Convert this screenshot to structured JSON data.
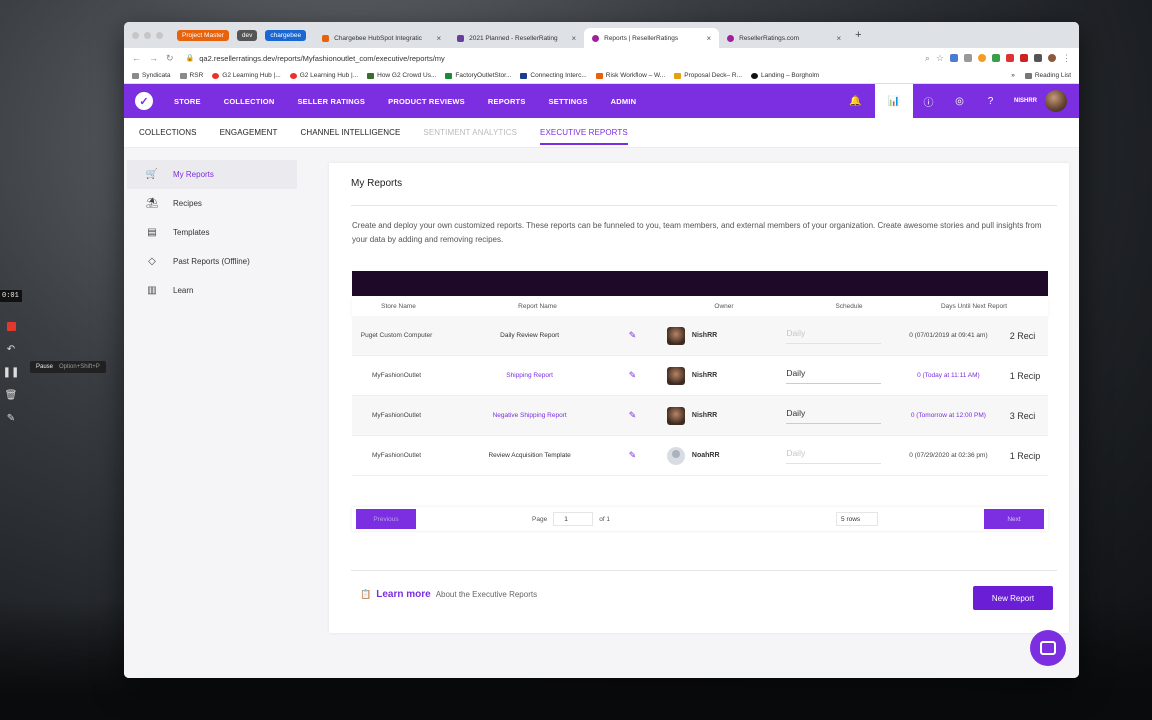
{
  "recorder": {
    "time": "0:01",
    "tooltip": "Pause",
    "tooltip_kbd": "Option+Shift+P"
  },
  "browser": {
    "pills": [
      "Project Master",
      "dev",
      "chargebee"
    ],
    "tabs": [
      {
        "label": "Chargebee HubSpot Integratic",
        "color": "#e8620c"
      },
      {
        "label": "2021 Planned - ResellerRating",
        "color": "#6a3e9e"
      },
      {
        "label": "Reports | ResellerRatings",
        "color": "#a0209e"
      },
      {
        "label": "ResellerRatings.com",
        "color": "#a0209e"
      }
    ],
    "url": "qa2.resellerratings.dev/reports/Myfashionoutlet_com/executive/reports/my",
    "bookmarks": [
      {
        "label": "Syndicata",
        "color": "#8a8a8a"
      },
      {
        "label": "RSR",
        "color": "#8a8a8a"
      },
      {
        "label": "G2 Learning Hub |...",
        "color": "#e8332a"
      },
      {
        "label": "G2 Learning Hub |...",
        "color": "#e8332a"
      },
      {
        "label": "How G2 Crowd Us...",
        "color": "#3b6e2e"
      },
      {
        "label": "FactoryOutletStor...",
        "color": "#1a8a3a"
      },
      {
        "label": "Connecting Interc...",
        "color": "#1b3d8f"
      },
      {
        "label": "Risk Workflow – W...",
        "color": "#e8620c"
      },
      {
        "label": "Proposal Deck– R...",
        "color": "#e5a00d"
      },
      {
        "label": "Landing – Borgholm",
        "color": "#111111"
      }
    ],
    "reading_list": "Reading List"
  },
  "nav": {
    "items": [
      "STORE",
      "COLLECTION",
      "SELLER RATINGS",
      "PRODUCT REVIEWS",
      "REPORTS",
      "SETTINGS",
      "ADMIN"
    ],
    "user": "NISHRR"
  },
  "subnav": {
    "items": [
      {
        "label": "COLLECTIONS",
        "state": "normal"
      },
      {
        "label": "ENGAGEMENT",
        "state": "normal"
      },
      {
        "label": "CHANNEL INTELLIGENCE",
        "state": "normal"
      },
      {
        "label": "SENTIMENT ANALYTICS",
        "state": "disabled"
      },
      {
        "label": "EXECUTIVE REPORTS",
        "state": "active"
      }
    ]
  },
  "sidebar": {
    "items": [
      {
        "label": "My Reports",
        "icon": "cart-icon"
      },
      {
        "label": "Recipes",
        "icon": "recipe-icon"
      },
      {
        "label": "Templates",
        "icon": "template-icon"
      },
      {
        "label": "Past Reports (Offline)",
        "icon": "tag-icon"
      },
      {
        "label": "Learn",
        "icon": "book-icon"
      }
    ]
  },
  "main": {
    "title": "My Reports",
    "description": "Create and deploy your own customized reports. These reports can be funneled to you, team members, and external members of your organization. Create awesome stories and pull insights from your data by adding and removing recipes.",
    "columns": [
      "Store Name",
      "Report Name",
      "Owner",
      "Schedule",
      "Days Until Next Report"
    ],
    "rows": [
      {
        "store": "Puget Custom Computer",
        "name": "Daily Review Report",
        "owner": "NishRR",
        "schedule": "Daily",
        "next": "0 (07/01/2019 at 09:41 am)",
        "recipes": "2 Reci"
      },
      {
        "store": "MyFashionOutlet",
        "name": "Shipping Report",
        "owner": "NishRR",
        "schedule": "Daily",
        "next": "0 (Today at 11:11 AM)",
        "recipes": "1 Recip"
      },
      {
        "store": "MyFashionOutlet",
        "name": "Negative Shipping Report",
        "owner": "NishRR",
        "schedule": "Daily",
        "next": "0 (Tomorrow at 12:00 PM)",
        "recipes": "3 Reci"
      },
      {
        "store": "MyFashionOutlet",
        "name": "Review Acquisition Template",
        "owner": "NoahRR",
        "schedule": "Daily",
        "next": "0 (07/29/2020 at 02:36 pm)",
        "recipes": "1 Recip"
      }
    ],
    "pager": {
      "previous": "Previous",
      "page_label": "Page",
      "page": "1",
      "of": "of 1",
      "rows": "5 rows",
      "next": "Next"
    },
    "learn_more": "Learn more",
    "learn_sub": "About the Executive Reports",
    "new_report": "New Report"
  },
  "colors": {
    "brand": "#7b2fe0",
    "table_header": "#1f0928"
  }
}
